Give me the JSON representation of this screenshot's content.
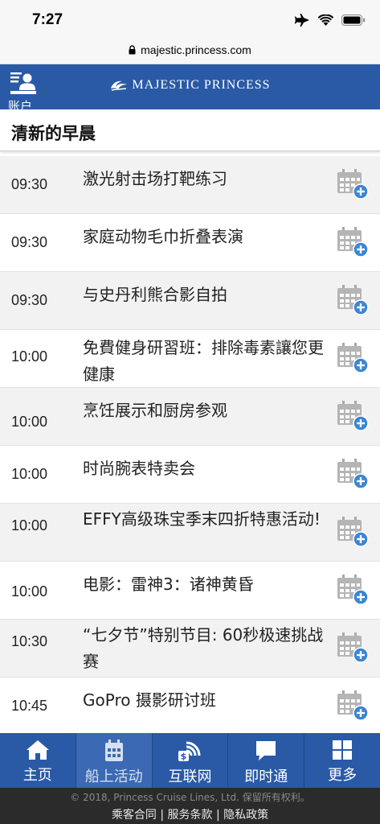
{
  "status_bar": {
    "time": "7:27"
  },
  "url_bar": {
    "domain": "majestic.princess.com"
  },
  "header": {
    "account_label": "账户",
    "logo_text": "MAJESTIC PRINCESS"
  },
  "section": {
    "title": "清新的早晨"
  },
  "events": [
    {
      "time": "09:30",
      "name": "激光射击场打靶练习"
    },
    {
      "time": "09:30",
      "name": "家庭动物毛巾折叠表演"
    },
    {
      "time": "09:30",
      "name": "与史丹利熊合影自拍"
    },
    {
      "time": "10:00",
      "name": "免費健身研習班：排除毒素讓您更健康"
    },
    {
      "time": "10:00",
      "name": "烹饪展示和厨房参观"
    },
    {
      "time": "10:00",
      "name": "时尚腕表特卖会"
    },
    {
      "time": "10:00",
      "name": "EFFY高级珠宝季末四折特惠活动!"
    },
    {
      "time": "10:00",
      "name": "电影：雷神3：诸神黄昏"
    },
    {
      "time": "10:30",
      "name": "“七夕节”特别节目: 60秒极速挑战赛"
    },
    {
      "time": "10:45",
      "name": "GoPro 摄影研讨班"
    }
  ],
  "nav": [
    {
      "label": "主页",
      "icon": "home-icon"
    },
    {
      "label": "船上活动",
      "icon": "calendar-icon"
    },
    {
      "label": "互联网",
      "icon": "wifi-dollar-icon"
    },
    {
      "label": "即时通",
      "icon": "chat-icon"
    },
    {
      "label": "更多",
      "icon": "grid-icon"
    }
  ],
  "footer": {
    "copyright": "© 2018, Princess Cruise Lines, Ltd. 保留所有权利。",
    "links": "乘客合同 | 服务条款 | 隐私政策"
  },
  "colors": {
    "brand_blue": "#2a5aa6",
    "row_alt": "#f2f2f2",
    "footer_bg": "#2b2b2b",
    "add_badge": "#3a86d4"
  }
}
